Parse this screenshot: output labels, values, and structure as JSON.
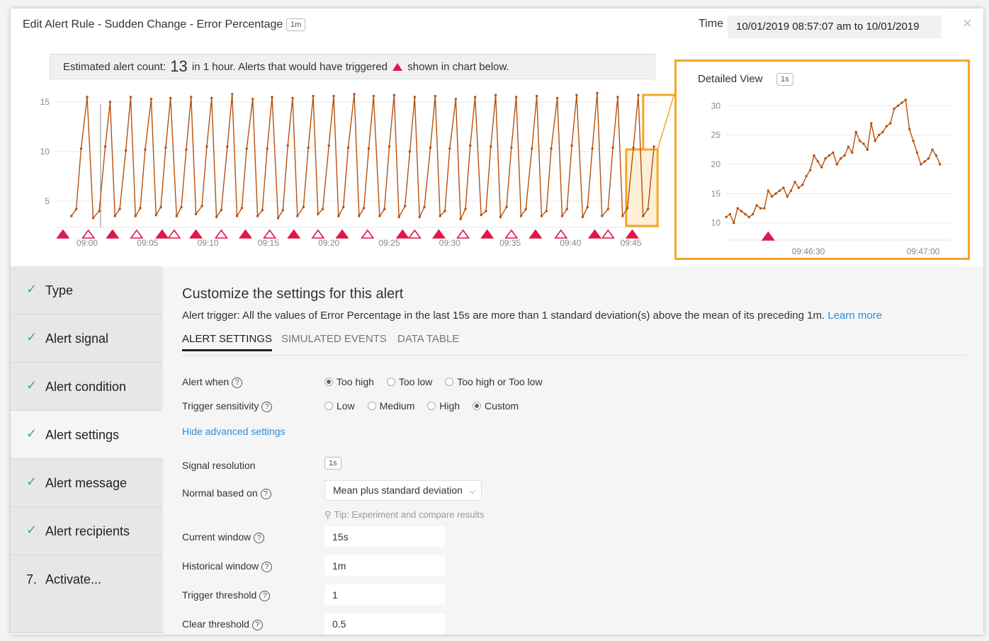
{
  "header": {
    "title": "Edit Alert Rule - Sudden Change - Error Percentage",
    "title_chip": "1m",
    "time_label": "Time",
    "time_value": "10/01/2019 08:57:07 am to 10/01/2019",
    "close_glyph": "×"
  },
  "estimate": {
    "prefix": "Estimated alert count:",
    "count": "13",
    "middle": "in 1 hour. Alerts that would have triggered",
    "suffix": "shown in chart below."
  },
  "colors": {
    "line": "#b5510f",
    "alert": "#e0174a",
    "highlight": "#f5a623",
    "check": "#3bb54a",
    "link": "#2d8dd8"
  },
  "chart_data": [
    {
      "type": "line",
      "title": "",
      "ylim": [
        2,
        16
      ],
      "y_ticks": [
        5,
        10,
        15
      ],
      "x_ticks": [
        "09:00",
        "09:05",
        "09:10",
        "09:15",
        "09:20",
        "09:25",
        "09:30",
        "09:35",
        "09:40",
        "09:45"
      ],
      "x": [
        -1.3,
        -0.9,
        -0.5,
        0.0,
        0.5,
        1.0,
        1.5,
        1.9,
        2.3,
        2.7,
        3.2,
        3.6,
        4.0,
        4.4,
        4.8,
        5.3,
        5.7,
        6.1,
        6.5,
        6.9,
        7.4,
        7.8,
        8.2,
        8.6,
        9.0,
        9.5,
        9.9,
        10.3,
        10.7,
        11.1,
        11.6,
        12.0,
        12.4,
        12.8,
        13.2,
        13.7,
        14.1,
        14.5,
        14.9,
        15.3,
        15.8,
        16.2,
        16.6,
        17.0,
        17.4,
        17.9,
        18.3,
        18.7,
        19.1,
        19.5,
        20.0,
        20.4,
        20.8,
        21.2,
        21.6,
        22.1,
        22.5,
        22.9,
        23.3,
        23.7,
        24.2,
        24.6,
        25.0,
        25.4,
        25.8,
        26.3,
        26.7,
        27.1,
        27.5,
        27.9,
        28.4,
        28.8,
        29.2,
        29.6,
        30.0,
        30.5,
        30.9,
        31.3,
        31.7,
        32.1,
        32.6,
        33.0,
        33.4,
        33.8,
        34.2,
        34.7,
        35.1,
        35.5,
        35.9,
        36.3,
        36.8,
        37.2,
        37.6,
        38.0,
        38.4,
        38.9,
        39.3,
        39.7,
        40.1,
        40.5,
        41.0,
        41.4,
        41.8,
        42.2,
        42.6,
        43.1,
        43.5,
        43.9,
        44.3,
        44.7,
        45.2,
        45.6,
        46.0,
        46.4,
        46.9
      ],
      "series": [
        {
          "name": "",
          "values": [
            3.5,
            4.2,
            10.3,
            15.5,
            3.3,
            4.0,
            10.5,
            15.0,
            3.5,
            4.2,
            10.1,
            15.5,
            3.5,
            4.3,
            10.2,
            15.3,
            3.6,
            4.4,
            10.4,
            15.4,
            3.5,
            4.4,
            10.2,
            15.5,
            3.7,
            4.5,
            10.5,
            15.4,
            3.4,
            4.1,
            10.5,
            15.8,
            3.5,
            4.3,
            10.3,
            15.3,
            3.5,
            4.1,
            10.3,
            15.5,
            3.3,
            4.1,
            10.6,
            15.4,
            3.5,
            4.4,
            10.4,
            15.6,
            3.7,
            4.2,
            10.6,
            15.6,
            3.5,
            4.4,
            10.4,
            15.8,
            3.5,
            4.3,
            10.3,
            15.6,
            3.5,
            4.2,
            10.5,
            15.7,
            3.4,
            4.5,
            10.0,
            15.5,
            3.4,
            4.4,
            10.4,
            15.6,
            3.5,
            4.0,
            10.3,
            15.3,
            3.2,
            4.2,
            10.6,
            15.5,
            3.6,
            4.0,
            10.5,
            15.7,
            3.4,
            4.4,
            10.4,
            15.5,
            3.5,
            4.2,
            10.3,
            15.6,
            3.5,
            4.0,
            10.3,
            15.4,
            3.5,
            4.2,
            10.6,
            15.7,
            3.4,
            4.4,
            10.3,
            15.9,
            3.5,
            4.2,
            10.4,
            15.5,
            3.5,
            4.3,
            10.4,
            15.7,
            3.5,
            4.2,
            10.5
          ]
        }
      ],
      "alerts": [
        {
          "t": -2.0,
          "triggered": true
        },
        {
          "t": 0.1,
          "triggered": false
        },
        {
          "t": 2.1,
          "triggered": true
        },
        {
          "t": 4.1,
          "triggered": false
        },
        {
          "t": 6.2,
          "triggered": true
        },
        {
          "t": 7.2,
          "triggered": false
        },
        {
          "t": 9.0,
          "triggered": true
        },
        {
          "t": 11.1,
          "triggered": false
        },
        {
          "t": 13.1,
          "triggered": true
        },
        {
          "t": 15.1,
          "triggered": false
        },
        {
          "t": 17.1,
          "triggered": true
        },
        {
          "t": 19.1,
          "triggered": false
        },
        {
          "t": 21.1,
          "triggered": true
        },
        {
          "t": 23.2,
          "triggered": false
        },
        {
          "t": 26.1,
          "triggered": true
        },
        {
          "t": 27.1,
          "triggered": false
        },
        {
          "t": 29.1,
          "triggered": true
        },
        {
          "t": 31.1,
          "triggered": false
        },
        {
          "t": 33.1,
          "triggered": true
        },
        {
          "t": 35.1,
          "triggered": false
        },
        {
          "t": 37.1,
          "triggered": true
        },
        {
          "t": 39.2,
          "triggered": false
        },
        {
          "t": 42.0,
          "triggered": true
        },
        {
          "t": 43.1,
          "triggered": false
        },
        {
          "t": 45.1,
          "triggered": true
        }
      ],
      "highlight_range": [
        44.6,
        47.2
      ]
    },
    {
      "type": "line",
      "title": "Detailed View",
      "title_chip": "1s",
      "ylim": [
        9,
        31
      ],
      "y_ticks": [
        10,
        15,
        20,
        25,
        30
      ],
      "x_ticks": [
        "09:46:30",
        "09:47:00"
      ],
      "x": [
        0,
        1,
        2,
        3,
        4,
        5,
        6,
        7,
        8,
        9,
        10,
        11,
        12,
        13,
        14,
        15,
        16,
        17,
        18,
        19,
        20,
        21,
        22,
        23,
        24,
        25,
        26,
        27,
        28,
        29,
        30,
        31,
        32,
        33,
        34,
        35,
        36,
        37,
        38,
        39,
        40,
        41,
        42,
        43,
        44,
        45,
        46,
        47,
        48,
        49,
        50,
        51,
        52,
        53,
        54,
        55,
        56,
        57,
        58,
        59
      ],
      "series": [
        {
          "name": "",
          "values": [
            11.0,
            11.5,
            10.0,
            12.5,
            12.0,
            11.5,
            11.0,
            11.5,
            13.0,
            12.5,
            12.5,
            15.5,
            14.5,
            15.0,
            15.5,
            16.0,
            14.5,
            15.5,
            17.0,
            16.0,
            16.5,
            18.0,
            19.0,
            21.5,
            20.5,
            19.5,
            21.0,
            21.5,
            22.0,
            20.0,
            21.0,
            21.5,
            23.0,
            22.0,
            25.5,
            24.0,
            23.5,
            22.5,
            27.0,
            24.0,
            25.0,
            25.5,
            26.5,
            27.0,
            29.5,
            30.0,
            30.5,
            31.0,
            26.0,
            24.0,
            22.0,
            20.0,
            20.5,
            21.0,
            22.5,
            21.5,
            20.0
          ]
        }
      ],
      "alerts": [
        {
          "t": 11.0,
          "triggered": true
        }
      ],
      "x_range": [
        0,
        59
      ]
    }
  ],
  "steps": [
    {
      "marker": "✓",
      "label": "Type"
    },
    {
      "marker": "✓",
      "label": "Alert signal"
    },
    {
      "marker": "✓",
      "label": "Alert condition"
    },
    {
      "marker": "✓",
      "label": "Alert settings"
    },
    {
      "marker": "✓",
      "label": "Alert message"
    },
    {
      "marker": "✓",
      "label": "Alert recipients"
    },
    {
      "marker": "7.",
      "label": "Activate..."
    }
  ],
  "settings": {
    "heading": "Customize the settings for this alert",
    "trigger_text": "Alert trigger: All the values of Error Percentage in the last 15s are more than 1 standard deviation(s) above the mean of its preceding 1m.",
    "learn_more": "Learn more",
    "tabs": [
      "ALERT SETTINGS",
      "SIMULATED EVENTS",
      "DATA TABLE"
    ],
    "alert_when_label": "Alert when",
    "alert_when_options": [
      "Too high",
      "Too low",
      "Too high or Too low"
    ],
    "sensitivity_label": "Trigger sensitivity",
    "sensitivity_options": [
      "Low",
      "Medium",
      "High",
      "Custom"
    ],
    "advanced_link": "Hide advanced settings",
    "resolution_label": "Signal resolution",
    "resolution_value": "1s",
    "normal_label": "Normal based on",
    "normal_value": "Mean plus standard deviation",
    "tip": "Tip: Experiment and compare results",
    "current_window_label": "Current window",
    "current_window_value": "15s",
    "historical_window_label": "Historical window",
    "historical_window_value": "1m",
    "trigger_threshold_label": "Trigger threshold",
    "trigger_threshold_value": "1",
    "clear_threshold_label": "Clear threshold",
    "clear_threshold_value": "0.5",
    "help_glyph": "?"
  }
}
